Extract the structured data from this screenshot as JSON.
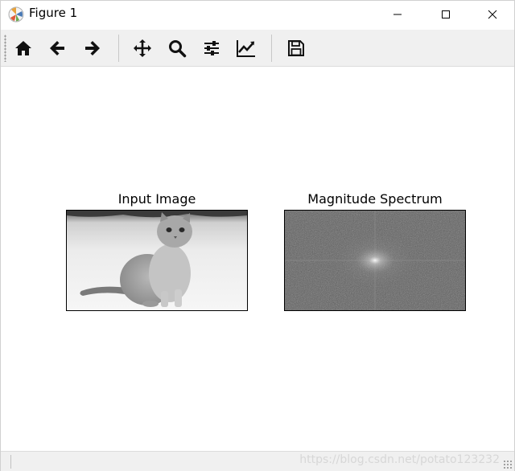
{
  "window": {
    "title": "Figure 1",
    "controls": [
      "minimize",
      "maximize",
      "close"
    ]
  },
  "toolbar": {
    "tools": [
      {
        "name": "home",
        "icon": "home-icon"
      },
      {
        "name": "back",
        "icon": "arrow-left-icon"
      },
      {
        "name": "forward",
        "icon": "arrow-right-icon"
      },
      {
        "name": "pan",
        "icon": "move-icon"
      },
      {
        "name": "zoom",
        "icon": "search-icon"
      },
      {
        "name": "configure-subplots",
        "icon": "sliders-icon"
      },
      {
        "name": "edit-axes",
        "icon": "line-chart-icon"
      },
      {
        "name": "save",
        "icon": "save-icon"
      }
    ]
  },
  "figure": {
    "subplots": [
      {
        "title": "Input Image",
        "content": "grayscale photo of a sitting cat in snow"
      },
      {
        "title": "Magnitude Spectrum",
        "content": "noisy gray Fourier magnitude spectrum with bright center"
      }
    ]
  },
  "statusbar": {
    "watermark": "https://blog.csdn.net/potato123232"
  }
}
